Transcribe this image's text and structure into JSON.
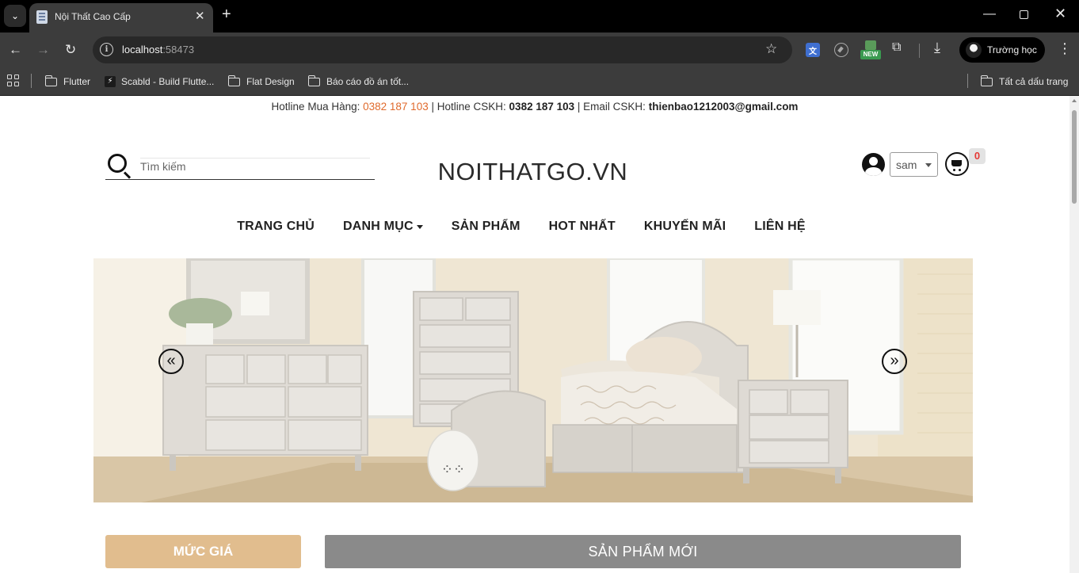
{
  "browser": {
    "tab_title": "Nội Thất Cao Cấp",
    "url_host": "localhost",
    "url_port": ":58473",
    "new_badge": "NEW",
    "profile_name": "Trường học",
    "bookmarks": [
      {
        "label": "Flutter",
        "icon": "folder-icon"
      },
      {
        "label": "Scabld - Build Flutte...",
        "icon": "bolt-icon"
      },
      {
        "label": "Flat Design",
        "icon": "folder-icon"
      },
      {
        "label": "Báo cáo đồ án tốt...",
        "icon": "folder-icon"
      }
    ],
    "all_bookmarks": "Tất cả dấu trang"
  },
  "topbar": {
    "hotline_buy_label": "Hotline Mua Hàng:",
    "hotline_buy": "0382 187 103",
    "hotline_cskh_label": "| Hotline CSKH:",
    "hotline_cskh": "0382 187 103",
    "email_label": "| Email CSKH:",
    "email": "thienbao1212003@gmail.com"
  },
  "header": {
    "search_placeholder": "Tìm kiếm",
    "logo": "NOITHATGO.VN",
    "user_select": "sam",
    "cart_count": "0"
  },
  "nav": {
    "items": [
      "TRANG CHỦ",
      "DANH MỤC",
      "SẢN PHẨM",
      "HOT NHẤT",
      "KHUYẾN MÃI",
      "LIÊN HỆ"
    ]
  },
  "carousel": {
    "prev": "«",
    "next": "»"
  },
  "sections": {
    "price_label": "MỨC GIÁ",
    "new_products_label": "SẢN PHẨM MỚI"
  },
  "colors": {
    "accent_orange": "#e06a2c",
    "price_button": "#e1bd8e",
    "new_products_bar": "#8a8a8a",
    "cart_badge": "#e53935"
  }
}
